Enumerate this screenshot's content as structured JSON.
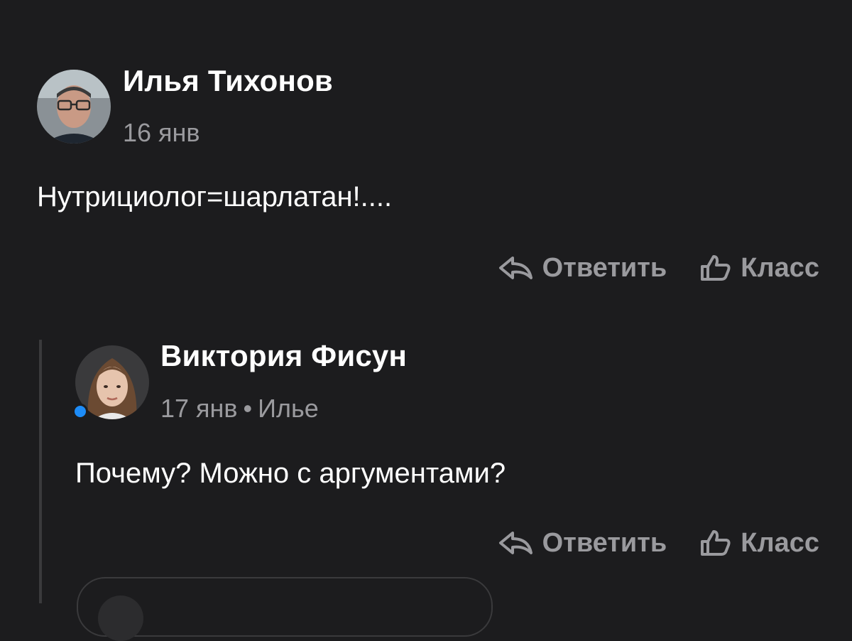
{
  "comments": [
    {
      "author": "Илья Тихонов",
      "date": "16 янв",
      "text": "Нутрициолог=шарлатан!....",
      "reply_label": "Ответить",
      "like_label": "Класс",
      "avatar_icon": "user-photo-icon"
    },
    {
      "author": "Виктория Фисун",
      "date": "17 янв",
      "separator": "•",
      "reply_to": "Илье",
      "text": "Почему? Можно с аргументами?",
      "reply_label": "Ответить",
      "like_label": "Класс",
      "avatar_icon": "user-photo-icon",
      "online": true
    }
  ],
  "colors": {
    "background": "#1c1c1e",
    "text": "#ffffff",
    "muted": "#9a9a9e",
    "online_dot": "#1d8cf8"
  }
}
